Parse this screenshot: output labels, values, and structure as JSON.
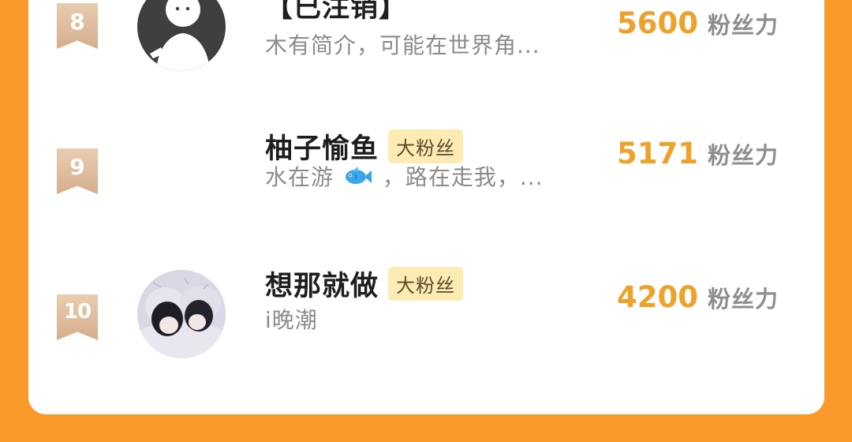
{
  "rows": [
    {
      "rank": "8",
      "name": "【已注销】",
      "badge": "",
      "bio": "木有简介，可能在世界角...",
      "score": "5600",
      "score_unit": "粉丝力",
      "avatar": "default-avatar"
    },
    {
      "rank": "9",
      "name": "柚子愉鱼",
      "badge": "大粉丝",
      "bio_before": "水在游",
      "bio_icon": "fish-emoji-icon",
      "bio_after": "，路在走我，...",
      "score": "5171",
      "score_unit": "粉丝力",
      "avatar": "none"
    },
    {
      "rank": "10",
      "name": "想那就做",
      "badge": "大粉丝",
      "bio": "i晚潮",
      "score": "4200",
      "score_unit": "粉丝力",
      "avatar": "photo-avatar"
    }
  ],
  "colors": {
    "background": "#F99A2B",
    "score": "#EDA22E",
    "badge_bg": "#FCEBB3",
    "rank_ribbon": "#D9B696"
  }
}
